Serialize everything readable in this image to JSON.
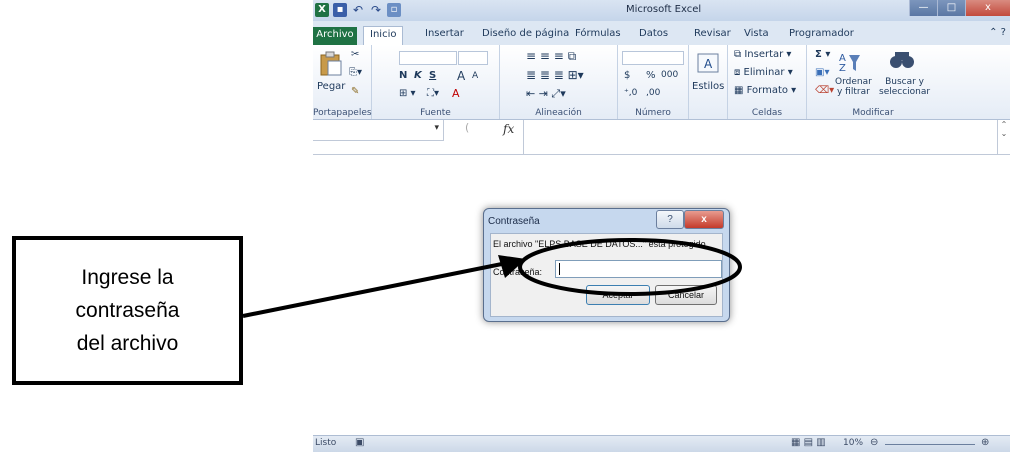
{
  "window": {
    "title": "Microsoft Excel",
    "controls": [
      "—",
      "□",
      "x"
    ]
  },
  "tabs": [
    "Archivo",
    "Inicio",
    "Insertar",
    "Diseño de página",
    "Fórmulas",
    "Datos",
    "Revisar",
    "Vista",
    "Programador"
  ],
  "ribbon": {
    "portapapeles": {
      "paste": "Pegar",
      "label": "Portapapeles"
    },
    "fuente": {
      "bold": "N",
      "italic": "K",
      "underline": "S",
      "grow": "A",
      "shrink": "A",
      "color": "A",
      "label": "Fuente"
    },
    "alineacion": {
      "label": "Alineación"
    },
    "numero": {
      "currency": "$",
      "percent": "%",
      "thousands": "000",
      "inc": "⁺,0",
      "dec": ",00",
      "label": "Número"
    },
    "estilos": {
      "label": "Estilos"
    },
    "celdas": {
      "insert": "Insertar",
      "delete": "Eliminar",
      "format": "Formato",
      "label": "Celdas"
    },
    "modificar": {
      "sigma": "Σ",
      "sort": "Ordenar",
      "sort2": "y filtrar",
      "find": "Buscar y",
      "find2": "seleccionar",
      "label": "Modificar"
    }
  },
  "formula_bar": {
    "fx": "fx"
  },
  "status": {
    "text": "Listo",
    "zoom": "10%"
  },
  "dialog": {
    "title": "Contraseña",
    "help": "?",
    "close": "x",
    "message": "El archivo \"ELPS BASE DE DATOS...\" está protegido.",
    "password_label": "Contraseña:",
    "ok": "Aceptar",
    "cancel": "Cancelar"
  },
  "callout": {
    "text": "Ingrese la\ncontraseña\ndel archivo"
  }
}
